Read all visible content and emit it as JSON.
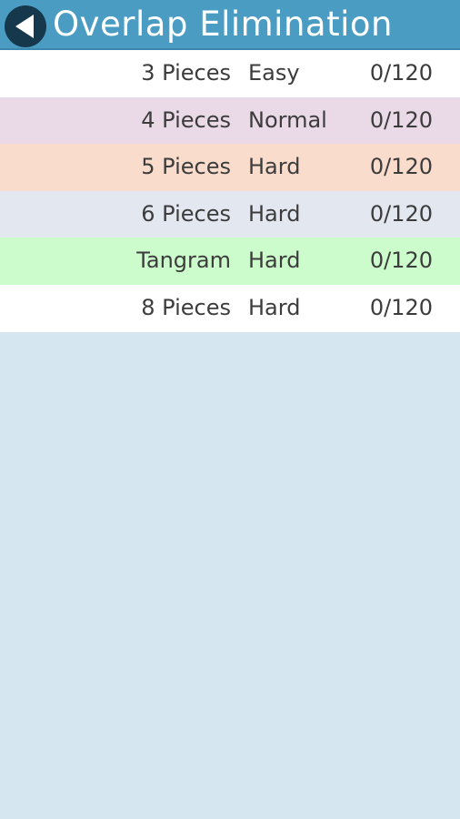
{
  "header": {
    "title": "Overlap Elimination",
    "back_icon": "back-arrow-icon",
    "background": "#4a9cc3"
  },
  "levels": [
    {
      "pieces": "3 Pieces",
      "difficulty": "Easy",
      "score": "0/120",
      "color": "#ffffff"
    },
    {
      "pieces": "4 Pieces",
      "difficulty": "Normal",
      "score": "0/120",
      "color": "#ead9e7"
    },
    {
      "pieces": "5 Pieces",
      "difficulty": "Hard",
      "score": "0/120",
      "color": "#f9dccb"
    },
    {
      "pieces": "6 Pieces",
      "difficulty": "Hard",
      "score": "0/120",
      "color": "#e3e7f0"
    },
    {
      "pieces": "Tangram",
      "difficulty": "Hard",
      "score": "0/120",
      "color": "#ccfccb"
    },
    {
      "pieces": "8 Pieces",
      "difficulty": "Hard",
      "score": "0/120",
      "color": "#ffffff"
    }
  ],
  "page_background": "#d5e6f0"
}
